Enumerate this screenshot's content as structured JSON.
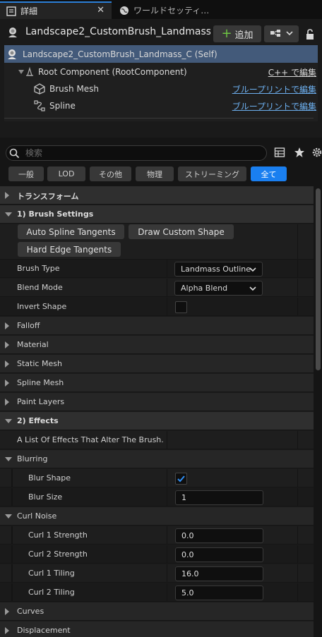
{
  "tabs": [
    {
      "label": "詳細",
      "close": "✕"
    },
    {
      "label": "ワールドセッティ…"
    }
  ],
  "header": {
    "title": "Landscape2_CustomBrush_Landmass",
    "add_label": "追加"
  },
  "tree": [
    {
      "label": "Landscape2_CustomBrush_Landmass_C (Self)"
    },
    {
      "label": "Root Component (RootComponent)",
      "link": "C++ で編集"
    },
    {
      "label": "Brush Mesh",
      "link": "ブループリントで編集"
    },
    {
      "label": "Spline",
      "link": "ブループリントで編集"
    }
  ],
  "search": {
    "placeholder": "検索"
  },
  "categories": [
    "一般",
    "LOD",
    "その他",
    "物理",
    "ストリーミング",
    "全て"
  ],
  "details": {
    "transform": "トランスフォーム",
    "brush_settings": "1) Brush Settings",
    "buttons": [
      "Auto Spline Tangents",
      "Draw Custom Shape",
      "Hard Edge Tangents"
    ],
    "brush_type": {
      "label": "Brush Type",
      "value": "Landmass Outline"
    },
    "blend_mode": {
      "label": "Blend Mode",
      "value": "Alpha Blend"
    },
    "invert_shape": {
      "label": "Invert Shape",
      "checked": false
    },
    "sections": [
      "Falloff",
      "Material",
      "Static Mesh",
      "Spline Mesh",
      "Paint Layers"
    ],
    "effects": "2) Effects",
    "effects_desc": "A List Of Effects That Alter The Brush.",
    "blurring": "Blurring",
    "blur_shape": {
      "label": "Blur Shape",
      "checked": true
    },
    "blur_size": {
      "label": "Blur Size",
      "value": "1"
    },
    "curl_noise": "Curl Noise",
    "curl1_strength": {
      "label": "Curl 1 Strength",
      "value": "0.0"
    },
    "curl2_strength": {
      "label": "Curl 2 Strength",
      "value": "0.0"
    },
    "curl1_tiling": {
      "label": "Curl 1 Tiling",
      "value": "16.0"
    },
    "curl2_tiling": {
      "label": "Curl 2 Tiling",
      "value": "5.0"
    },
    "curves": "Curves",
    "displacement": "Displacement"
  },
  "colors": {
    "accent": "#1a7ff0",
    "selection": "#435a7a",
    "link": "#6db0f0",
    "add": "#6ec543"
  },
  "icons": [
    "details-icon",
    "globe-icon",
    "actor-icon",
    "plus-icon",
    "blueprint-icon",
    "lock-icon",
    "component-icon",
    "mesh-icon",
    "spline-icon",
    "search-icon",
    "grid-icon",
    "star-icon",
    "gear-icon"
  ]
}
